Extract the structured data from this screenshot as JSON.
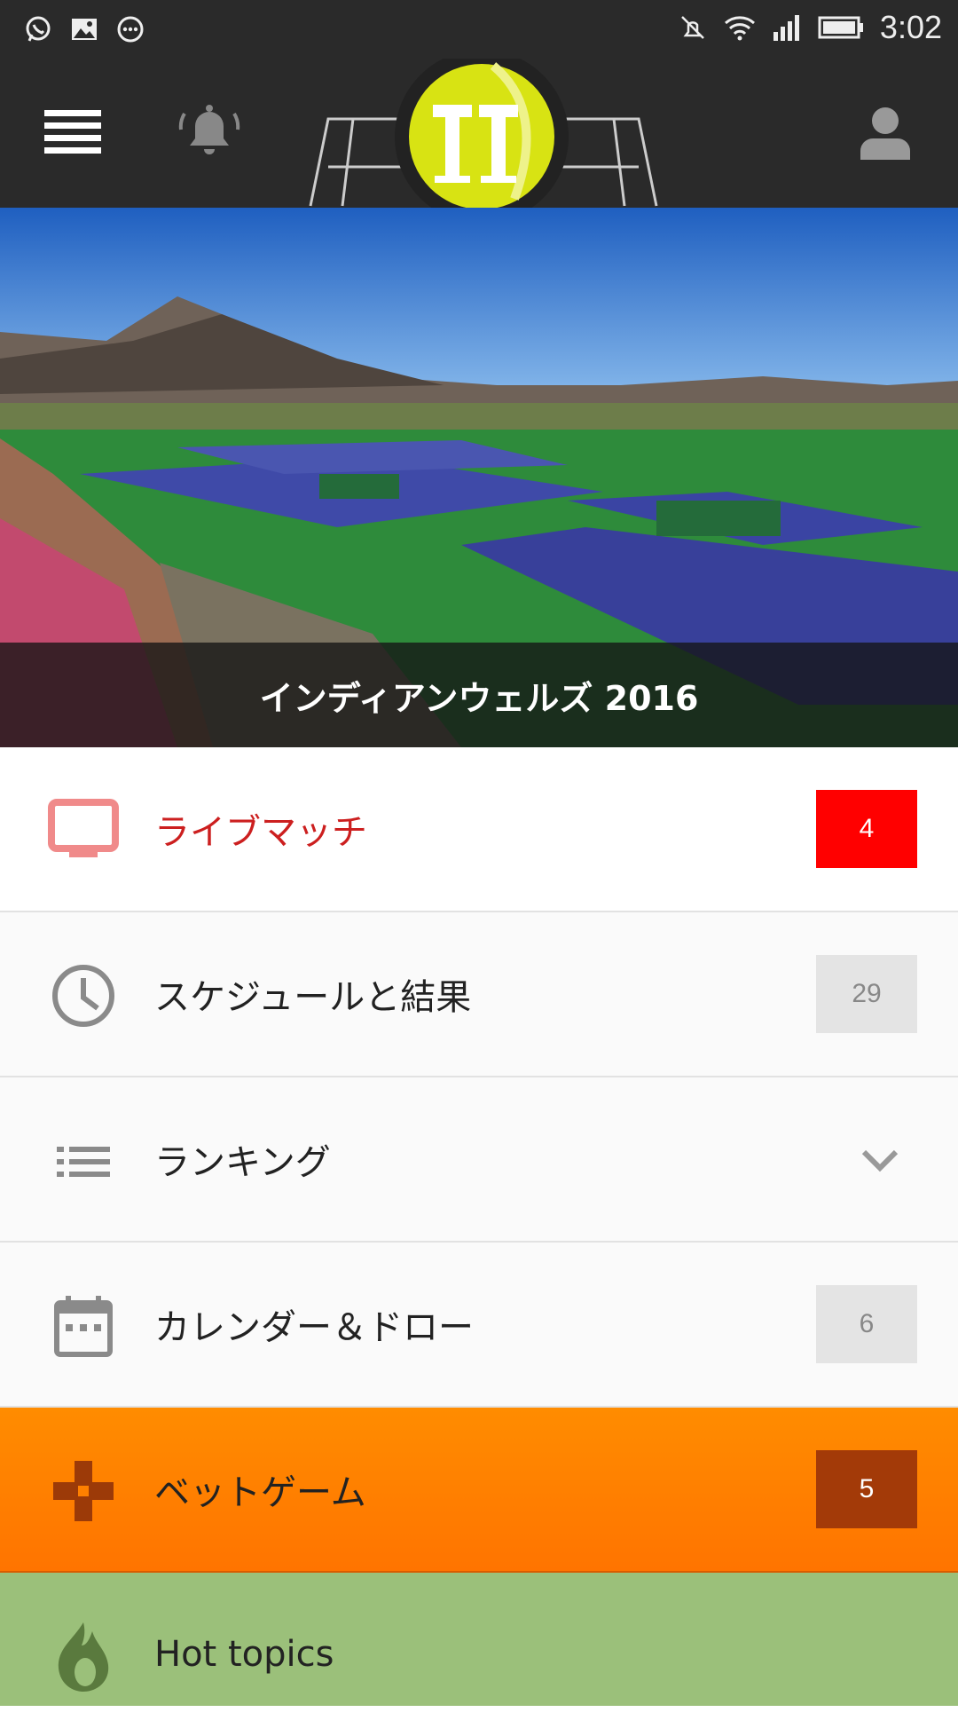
{
  "status_bar": {
    "time": "3:02",
    "left_icons": [
      "whatsapp-icon",
      "image-icon",
      "more-icon"
    ],
    "right_icons": [
      "mute-icon",
      "wifi-icon",
      "signal-icon",
      "battery-icon"
    ]
  },
  "app_bar": {
    "menu_icon": "menu-icon",
    "notification_icon": "bell-icon",
    "logo": "tennis-ball-logo",
    "account_icon": "user-icon"
  },
  "hero": {
    "title": "インディアンウェルズ 2016"
  },
  "menu": {
    "items": [
      {
        "label": "ライブマッチ",
        "badge": "4",
        "icon": "tv-icon"
      },
      {
        "label": "スケジュールと結果",
        "badge": "29",
        "icon": "clock-icon"
      },
      {
        "label": "ランキング",
        "icon": "list-icon",
        "trailing_icon": "chevron-down-icon"
      },
      {
        "label": "カレンダー＆ドロー",
        "badge": "6",
        "icon": "calendar-icon"
      },
      {
        "label": "ベットゲーム",
        "badge": "5",
        "icon": "gamepad-icon"
      },
      {
        "label": "Hot topics",
        "icon": "flame-icon"
      }
    ]
  },
  "colors": {
    "app_bar": "#2a2a2a",
    "live_accent": "#ff0000",
    "bet_row": "#ff8000",
    "hot_row": "#9bc07a",
    "logo_yellow": "#d8e313"
  }
}
